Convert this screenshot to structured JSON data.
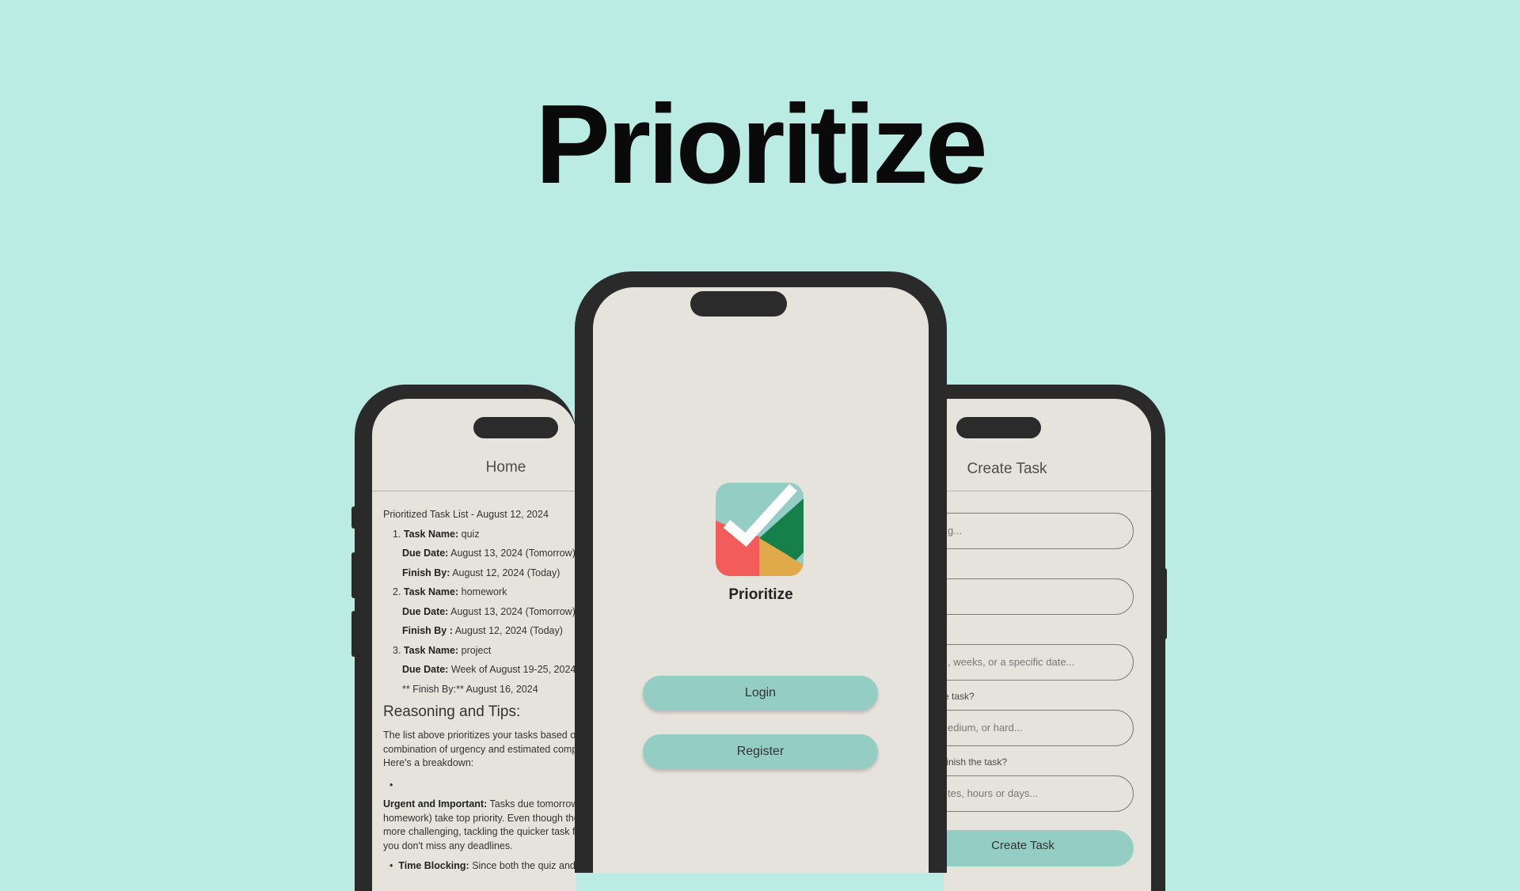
{
  "hero": {
    "title": "Prioritize"
  },
  "left_phone": {
    "nav_title": "Home",
    "list_heading": "Prioritized Task List - August 12, 2024",
    "tasks": [
      {
        "number": "1.",
        "name_label": "Task Name:",
        "name": "quiz",
        "due_label": "Due Date:",
        "due": "August 13, 2024 (Tomorrow)",
        "finish_label": "Finish By:",
        "finish": "August 12, 2024 (Today)"
      },
      {
        "number": "2.",
        "name_label": "Task Name:",
        "name": "homework",
        "due_label": "Due Date:",
        "due": "August 13, 2024 (Tomorrow)",
        "finish_label": "Finish By :",
        "finish": "August 12, 2024 (Today)"
      },
      {
        "number": "3.",
        "name_label": "Task Name:",
        "name": "project",
        "due_label": "Due Date:",
        "due": "Week of August 19-25, 2024",
        "finish_label": "** Finish By:**",
        "finish": "August 16, 2024"
      }
    ],
    "reasoning_heading": "Reasoning and Tips:",
    "reasoning_p1": "The list above prioritizes your tasks based on a",
    "reasoning_p2": "combination of urgency and estimated completion time.",
    "reasoning_p3": "Here's a breakdown:",
    "empty_bullet": "•",
    "urgent_label": "Urgent and Important:",
    "urgent_l1": " Tasks due tomorrow (quiz and",
    "urgent_l2": "homework) take top priority. Even though the quiz is",
    "urgent_l3": "more challenging, tackling the quicker task first ensures",
    "urgent_l4": "you don't miss any deadlines.",
    "tb_bullet": "•",
    "tb_label": "Time Blocking:",
    "tb_text": " Since both the quiz and homework"
  },
  "center_phone": {
    "app_name": "Prioritize",
    "login_label": "Login",
    "register_label": "Register",
    "logo_colors": {
      "teal": "#93cdc4",
      "green": "#16804a",
      "red": "#f45c5b",
      "gold": "#e0a94a",
      "check": "#ffffff"
    }
  },
  "right_phone": {
    "nav_title": "Create Task",
    "field1_placeholder": "g...",
    "field2_placeholder": "",
    "field3_placeholder": ", weeks, or a specific date...",
    "label4": "e task?",
    "field4_placeholder": "edium, or hard...",
    "label5": "finish the task?",
    "field5_placeholder": "tes, hours or days...",
    "create_label": "Create Task"
  }
}
